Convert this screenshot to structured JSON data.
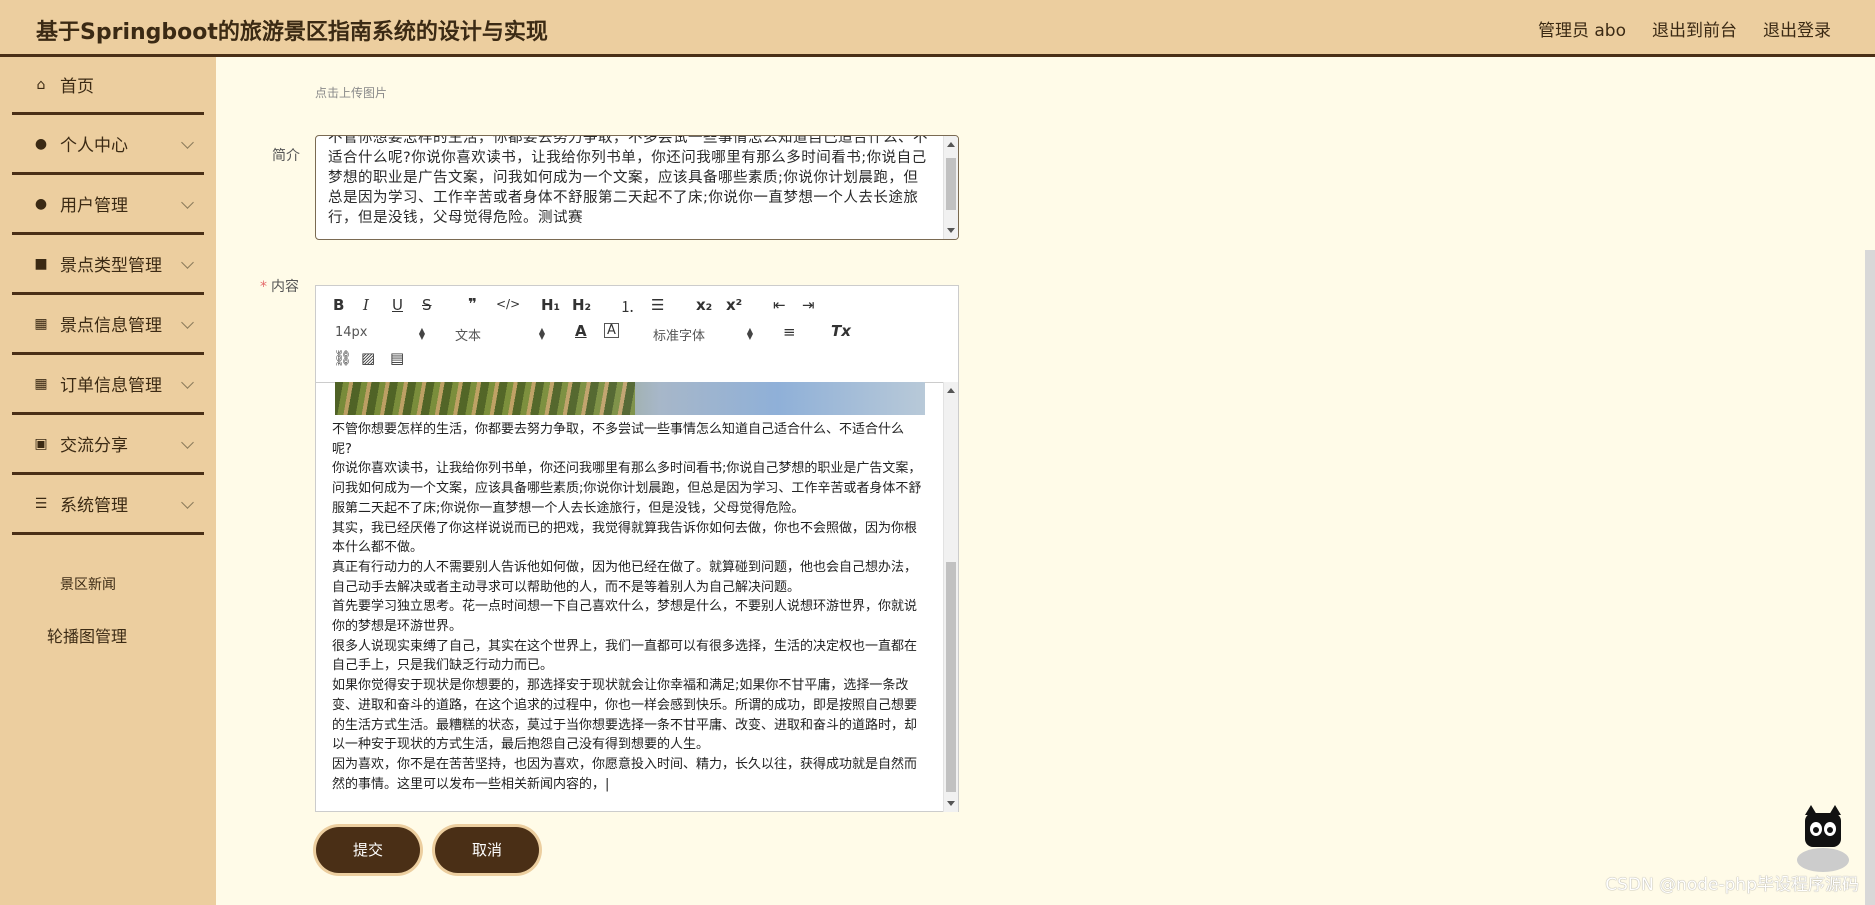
{
  "header": {
    "title": "基于Springboot的旅游景区指南系统的设计与实现",
    "user": "管理员 abo",
    "front_link": "退出到前台",
    "logout_link": "退出登录"
  },
  "sidebar": {
    "items": [
      {
        "label": "首页",
        "icon": "home-icon"
      },
      {
        "label": "个人中心",
        "icon": "user-icon"
      },
      {
        "label": "用户管理",
        "icon": "user-icon"
      },
      {
        "label": "景点类型管理",
        "icon": "briefcase-icon"
      },
      {
        "label": "景点信息管理",
        "icon": "grid-icon"
      },
      {
        "label": "订单信息管理",
        "icon": "grid-icon"
      },
      {
        "label": "交流分享",
        "icon": "clipboard-icon"
      },
      {
        "label": "系统管理",
        "icon": "sliders-icon"
      }
    ],
    "sub_items": [
      "景区新闻",
      "轮播图管理"
    ]
  },
  "form": {
    "upload_hint": "点击上传图片",
    "intro_label": "简介",
    "intro_text": "不管你想要怎样的生活，你都要去努力争取，不多尝试一些事情怎么知道自己适合什么、不适合什么呢?你说你喜欢读书，让我给你列书单，你还问我哪里有那么多时间看书;你说自己梦想的职业是广告文案，问我如何成为一个文案，应该具备哪些素质;你说你计划晨跑，但总是因为学习、工作辛苦或者身体不舒服第二天起不了床;你说你一直梦想一个人去长途旅行，但是没钱，父母觉得危险。测试赛",
    "content_label": "内容",
    "required_mark": "*",
    "content_paragraphs": [
      "不管你想要怎样的生活，你都要去努力争取，不多尝试一些事情怎么知道自己适合什么、不适合什么呢?",
      "你说你喜欢读书，让我给你列书单，你还问我哪里有那么多时间看书;你说自己梦想的职业是广告文案，问我如何成为一个文案，应该具备哪些素质;你说你计划晨跑，但总是因为学习、工作辛苦或者身体不舒服第二天起不了床;你说你一直梦想一个人去长途旅行，但是没钱，父母觉得危险。",
      "其实，我已经厌倦了你这样说说而已的把戏，我觉得就算我告诉你如何去做，你也不会照做，因为你根本什么都不做。",
      "真正有行动力的人不需要别人告诉他如何做，因为他已经在做了。就算碰到问题，他也会自己想办法，自己动手去解决或者主动寻求可以帮助他的人，而不是等着别人为自己解决问题。",
      "首先要学习独立思考。花一点时间想一下自己喜欢什么，梦想是什么，不要别人说想环游世界，你就说你的梦想是环游世界。",
      "很多人说现实束缚了自己，其实在这个世界上，我们一直都可以有很多选择，生活的决定权也一直都在自己手上，只是我们缺乏行动力而已。",
      "如果你觉得安于现状是你想要的，那选择安于现状就会让你幸福和满足;如果你不甘平庸，选择一条改变、进取和奋斗的道路，在这个追求的过程中，你也一样会感到快乐。所谓的成功，即是按照自己想要的生活方式生活。最糟糕的状态，莫过于当你想要选择一条不甘平庸、改变、进取和奋斗的道路时，却以一种安于现状的方式生活，最后抱怨自己没有得到想要的人生。",
      "因为喜欢，你不是在苦苦坚持，也因为喜欢，你愿意投入时间、精力，长久以往，获得成功就是自然而然的事情。这里可以发布一些相关新闻内容的，|"
    ],
    "editor": {
      "font_size": "14px",
      "header_picker": "文本",
      "font_picker": "标准字体",
      "tools": [
        "B",
        "I",
        "U",
        "S",
        "❞",
        "</>",
        "H₁",
        "H₂",
        "x₂",
        "x²",
        "Tx"
      ]
    },
    "submit_label": "提交",
    "cancel_label": "取消"
  },
  "watermark": "CSDN @node-php毕设程序源码"
}
